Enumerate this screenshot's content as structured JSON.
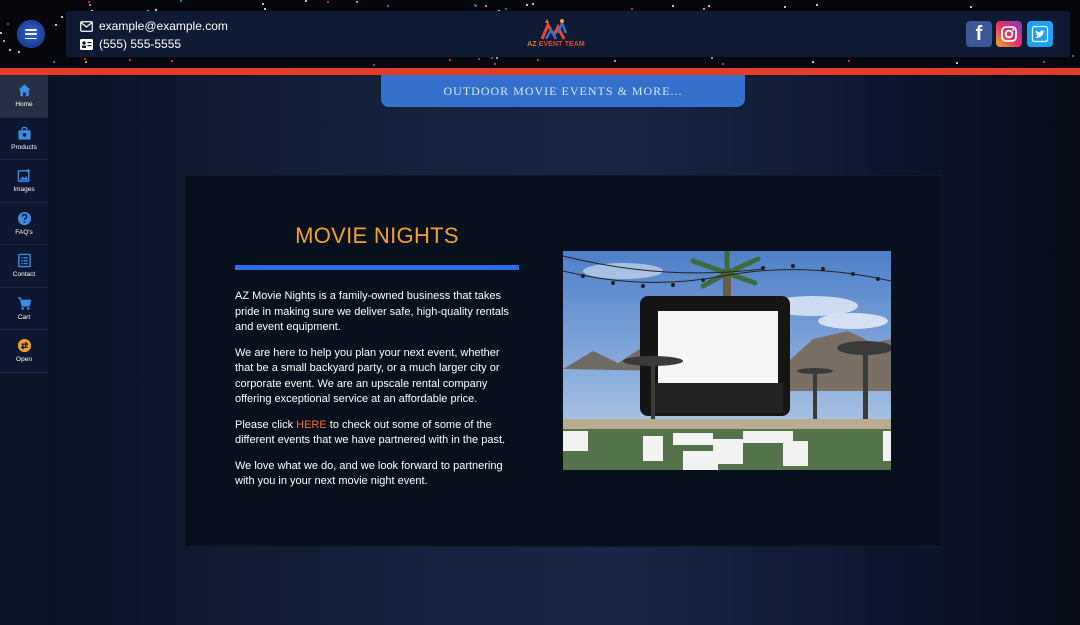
{
  "header": {
    "email": "example@example.com",
    "phone": "(555) 555-5555",
    "logo_text_a": "AZ ",
    "logo_text_b": "EVENT TEAM",
    "social": [
      "facebook-icon",
      "instagram-icon",
      "twitter-icon"
    ]
  },
  "sidebar": {
    "items": [
      {
        "label": "Home",
        "icon": "home-icon"
      },
      {
        "label": "Products",
        "icon": "bag-icon"
      },
      {
        "label": "Images",
        "icon": "image-icon"
      },
      {
        "label": "FAQ's",
        "icon": "question-icon"
      },
      {
        "label": "Contact",
        "icon": "contact-icon"
      },
      {
        "label": "Cart",
        "icon": "cart-icon"
      },
      {
        "label": "Open",
        "icon": "swap-icon"
      }
    ]
  },
  "banner": {
    "text": "OUTDOOR MOVIE EVENTS & MORE..."
  },
  "main": {
    "title": "MOVIE NIGHTS",
    "p1": "AZ Movie Nights is a family-owned business that takes pride in making sure we deliver safe, high-quality rentals and event equipment.",
    "p2": "We are here to help you plan your next event, whether that be a small backyard party, or a much larger city or corporate event. We are an upscale rental company offering exceptional service at an affordable price.",
    "p3_before": "Please click ",
    "p3_link": "HERE",
    "p3_after": " to check out some of some of the different events that we have partnered with in the past.",
    "p4": "We love what we do, and we look forward to partnering with you in your next movie night event."
  },
  "colors": {
    "accent_red": "#e23b26",
    "accent_blue": "#3570cc",
    "heading_orange": "#f0a22e",
    "link_orange": "#ef6b3f"
  }
}
